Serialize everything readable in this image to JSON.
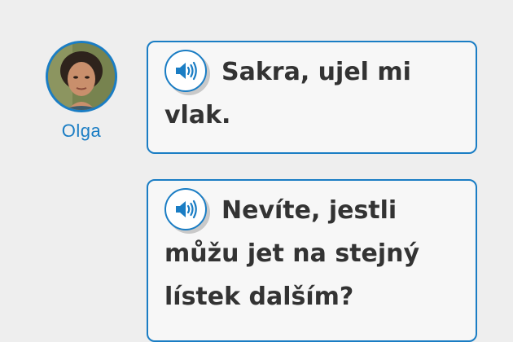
{
  "speaker": {
    "name": "Olga"
  },
  "dialogue": [
    {
      "text": "Sakra, ujel mi vlak.",
      "audio_icon": "speaker-volume-icon"
    },
    {
      "text": "Nevíte, jestli můžu jet na stejný lístek dalším?",
      "audio_icon": "speaker-volume-icon"
    }
  ],
  "colors": {
    "accent": "#1a7dc4",
    "text": "#333333",
    "background": "#eeeeee",
    "bubble_background": "#f7f7f7"
  }
}
